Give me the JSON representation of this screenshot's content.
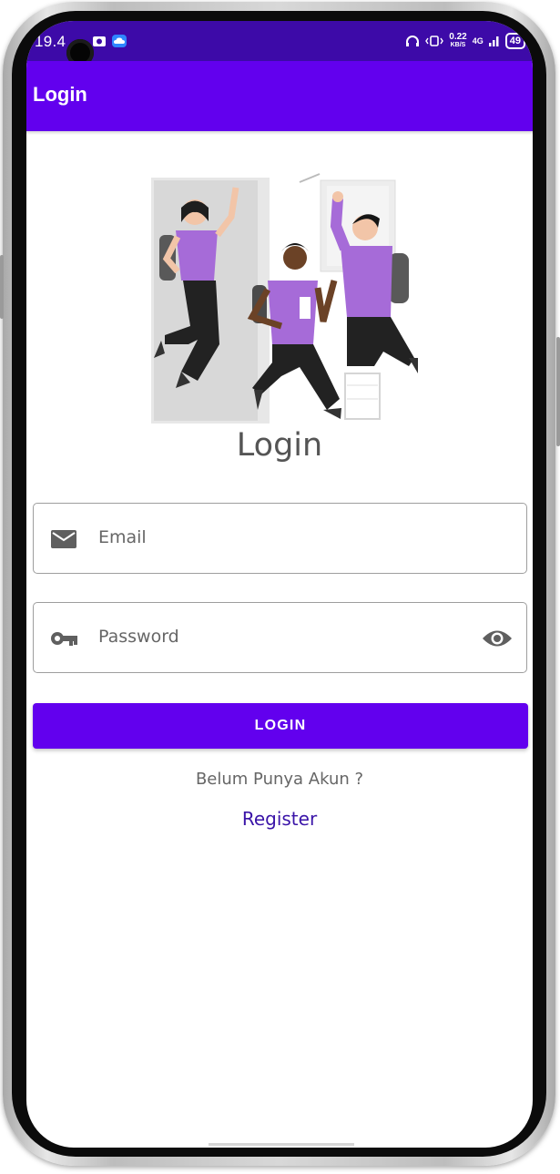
{
  "status_bar": {
    "time": "19.4",
    "net_speed_value": "0.22",
    "net_speed_unit": "KB/S",
    "network": "4G",
    "battery": "49"
  },
  "app_bar": {
    "title": "Login"
  },
  "heading": "Login",
  "email_field": {
    "placeholder": "Email",
    "icon": "envelope-icon"
  },
  "password_field": {
    "placeholder": "Password",
    "icon": "key-icon",
    "toggle_icon": "eye-icon"
  },
  "login_button": {
    "label": "LOGIN"
  },
  "no_account_text": "Belum Punya Akun ?",
  "register_link": "Register",
  "colors": {
    "primary": "#6200ee",
    "status_bar": "#3d0aa8",
    "illustration_accent": "#a66bd8",
    "link": "#3a14a8"
  }
}
